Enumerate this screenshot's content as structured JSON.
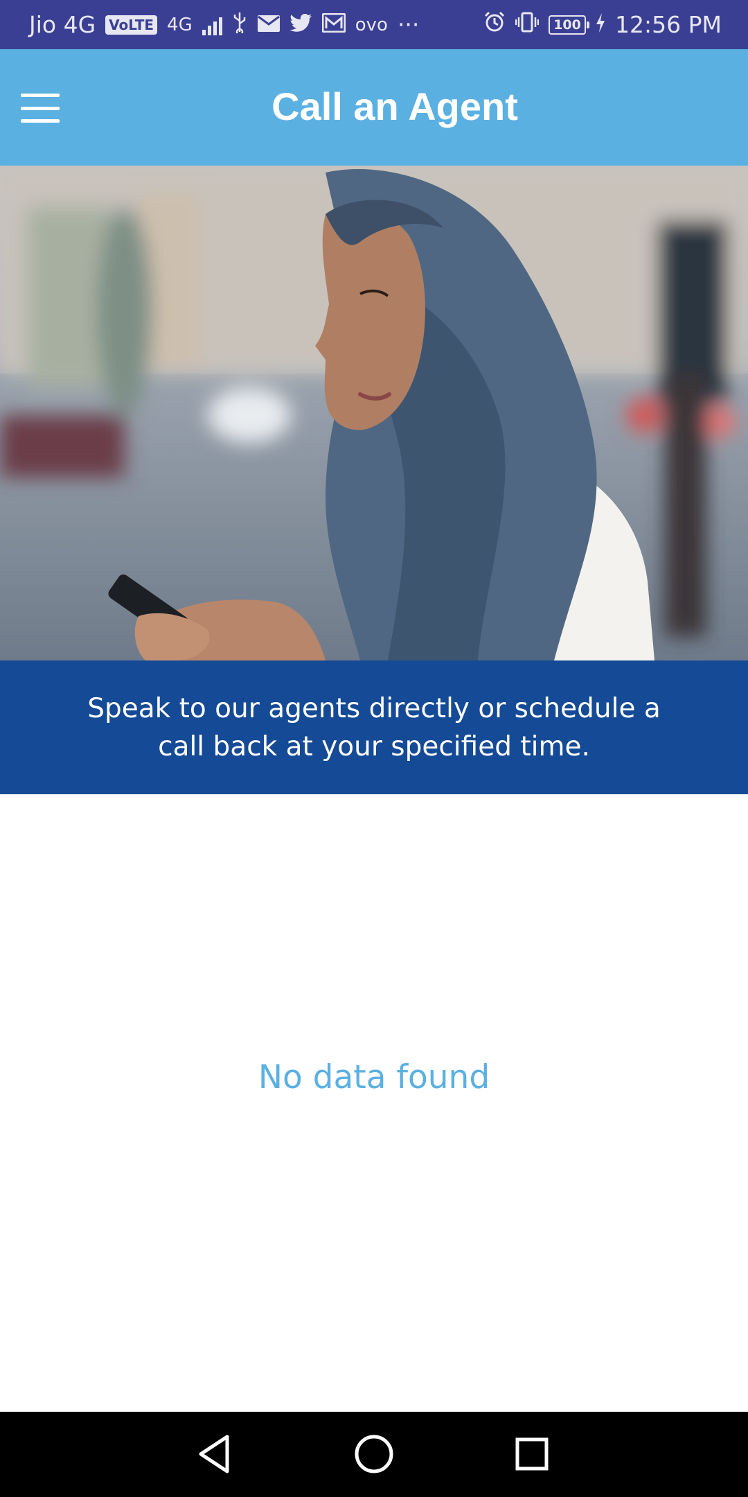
{
  "status_bar": {
    "carrier": "Jio 4G",
    "volte": "VoLTE",
    "net_type": "4G",
    "app_label": "ovo",
    "overflow": "···",
    "battery": "100",
    "time": "12:56 PM",
    "icons": [
      "signal-icon",
      "usb-icon",
      "mail-icon",
      "twitter-icon",
      "gmail-icon",
      "alarm-icon",
      "vibrate-icon",
      "battery-icon",
      "charging-icon"
    ]
  },
  "app_bar": {
    "title": "Call an Agent",
    "menu_icon": "hamburger-menu-icon",
    "color": "#5bb0e2"
  },
  "hero": {
    "image": "woman-in-headscarf-using-phone-photo"
  },
  "banner": {
    "text": "Speak to our agents directly or schedule a call back at your specified time.",
    "color": "#154a96"
  },
  "content": {
    "empty_message": "No data found",
    "message_color": "#5bb0e2"
  },
  "nav_bar": {
    "buttons": [
      "back-icon",
      "home-icon",
      "recents-icon"
    ]
  }
}
